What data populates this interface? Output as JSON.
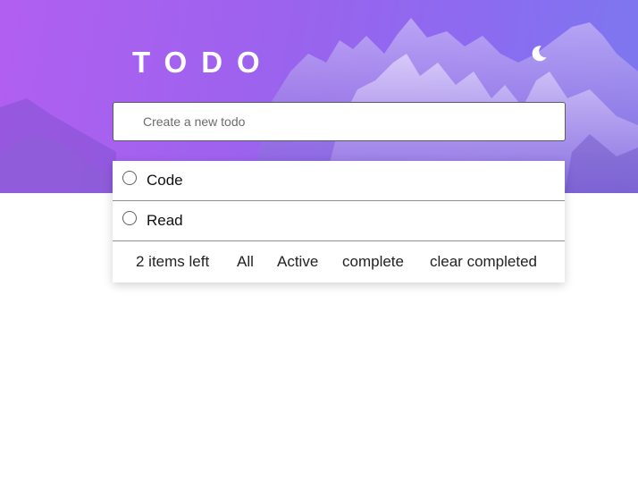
{
  "app": {
    "title": "TODO",
    "theme_icon": "moon-icon"
  },
  "new_todo": {
    "placeholder": "Create a new todo",
    "value": ""
  },
  "todos": [
    {
      "label": "Code",
      "completed": false
    },
    {
      "label": "Read",
      "completed": false
    }
  ],
  "footer": {
    "items_left": "2 items left",
    "filter_all": "All",
    "filter_active": "Active",
    "filter_complete": "complete",
    "clear_completed": "clear completed"
  },
  "colors": {
    "gradient_start": "#b15ff0",
    "gradient_end": "#7b78ef",
    "background": "#ffffff",
    "text": "#111111"
  }
}
